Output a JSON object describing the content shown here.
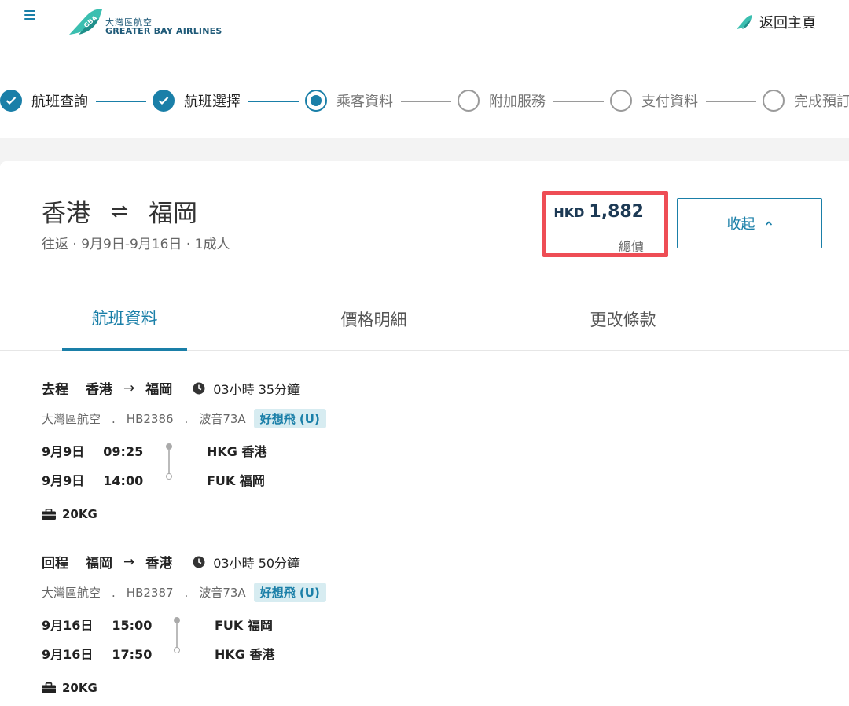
{
  "header": {
    "logo_cn": "大灣區航空",
    "logo_en": "GREATER BAY AIRLINES",
    "logo_mark": "GBA",
    "home_label": "返回主頁"
  },
  "stepper": {
    "steps": [
      {
        "label": "航班查詢",
        "state": "done"
      },
      {
        "label": "航班選擇",
        "state": "done"
      },
      {
        "label": "乘客資料",
        "state": "current"
      },
      {
        "label": "附加服務",
        "state": "todo"
      },
      {
        "label": "支付資料",
        "state": "todo"
      },
      {
        "label": "完成預訂",
        "state": "todo"
      }
    ]
  },
  "summary": {
    "origin": "香港",
    "destination": "福岡",
    "meta": "往返 · 9月9日-9月16日 · 1成人",
    "currency": "HKD",
    "total": "1,882",
    "total_caption": "總價",
    "collapse_label": "收起"
  },
  "tabs": [
    {
      "label": "航班資料",
      "active": true
    },
    {
      "label": "價格明細",
      "active": false
    },
    {
      "label": "更改條款",
      "active": false
    }
  ],
  "segments": [
    {
      "direction": "去程",
      "from": "香港",
      "to": "福岡",
      "duration": "03小時 35分鐘",
      "carrier": "大灣區航空",
      "flight_no": "HB2386",
      "aircraft": "波音73A",
      "fare": "好想飛 (U)",
      "dep_date": "9月9日",
      "dep_time": "09:25",
      "arr_date": "9月9日",
      "arr_time": "14:00",
      "dep_airport": "HKG 香港",
      "arr_airport": "FUK 福岡",
      "baggage": "20KG"
    },
    {
      "direction": "回程",
      "from": "福岡",
      "to": "香港",
      "duration": "03小時 50分鐘",
      "carrier": "大灣區航空",
      "flight_no": "HB2387",
      "aircraft": "波音73A",
      "fare": "好想飛 (U)",
      "dep_date": "9月16日",
      "dep_time": "15:00",
      "arr_date": "9月16日",
      "arr_time": "17:50",
      "dep_airport": "FUK 福岡",
      "arr_airport": "HKG 香港",
      "baggage": "20KG"
    }
  ],
  "colors": {
    "accent": "#1a7fa8",
    "highlight": "#ee4d55",
    "badge_bg": "#d7ecf1"
  },
  "icons": [
    "menu-icon",
    "logo-icon",
    "home-plane-icon",
    "check-icon",
    "swap-icon",
    "chevron-up-icon",
    "clock-icon",
    "baggage-icon"
  ]
}
